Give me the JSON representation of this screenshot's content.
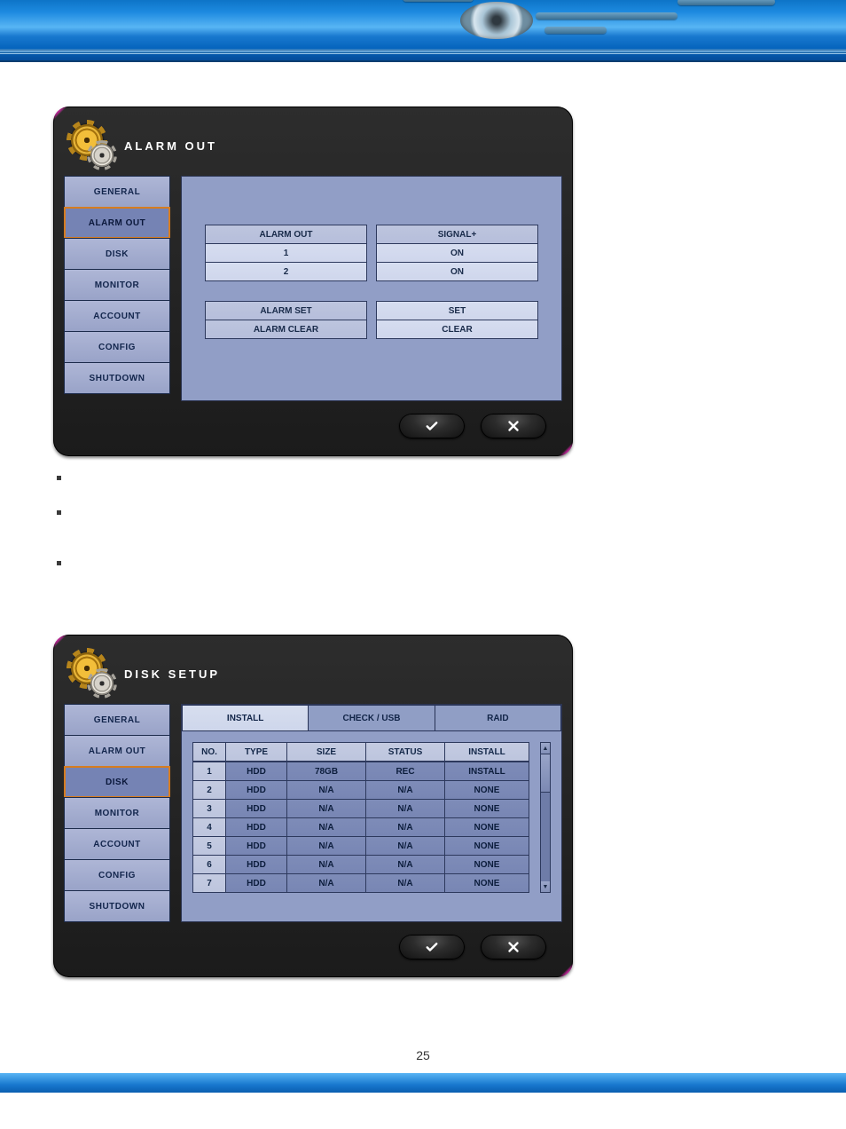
{
  "page_number": "25",
  "dialog_alarm": {
    "title": "ALARM OUT",
    "sidebar": {
      "items": [
        "GENERAL",
        "ALARM OUT",
        "DISK",
        "MONITOR",
        "ACCOUNT",
        "CONFIG",
        "SHUTDOWN"
      ],
      "active_index": 1
    },
    "group1": {
      "header": {
        "left": "ALARM OUT",
        "right": "SIGNAL+"
      },
      "rows": [
        {
          "left": "1",
          "right": "ON"
        },
        {
          "left": "2",
          "right": "ON"
        }
      ]
    },
    "group2": {
      "rows": [
        {
          "left": "ALARM SET",
          "right": "SET"
        },
        {
          "left": "ALARM CLEAR",
          "right": "CLEAR"
        }
      ]
    },
    "footer": {
      "ok_icon": "check-icon",
      "cancel_icon": "x-icon"
    }
  },
  "dialog_disk": {
    "title": "DISK SETUP",
    "sidebar": {
      "items": [
        "GENERAL",
        "ALARM OUT",
        "DISK",
        "MONITOR",
        "ACCOUNT",
        "CONFIG",
        "SHUTDOWN"
      ],
      "active_index": 2
    },
    "tabs": {
      "items": [
        "INSTALL",
        "CHECK / USB",
        "RAID"
      ],
      "active_index": 0
    },
    "table": {
      "columns": [
        "NO.",
        "TYPE",
        "SIZE",
        "STATUS",
        "INSTALL"
      ],
      "rows": [
        {
          "no": "1",
          "type": "HDD",
          "size": "78GB",
          "status": "REC",
          "install": "INSTALL"
        },
        {
          "no": "2",
          "type": "HDD",
          "size": "N/A",
          "status": "N/A",
          "install": "NONE"
        },
        {
          "no": "3",
          "type": "HDD",
          "size": "N/A",
          "status": "N/A",
          "install": "NONE"
        },
        {
          "no": "4",
          "type": "HDD",
          "size": "N/A",
          "status": "N/A",
          "install": "NONE"
        },
        {
          "no": "5",
          "type": "HDD",
          "size": "N/A",
          "status": "N/A",
          "install": "NONE"
        },
        {
          "no": "6",
          "type": "HDD",
          "size": "N/A",
          "status": "N/A",
          "install": "NONE"
        },
        {
          "no": "7",
          "type": "HDD",
          "size": "N/A",
          "status": "N/A",
          "install": "NONE"
        }
      ]
    },
    "footer": {
      "ok_icon": "check-icon",
      "cancel_icon": "x-icon"
    }
  }
}
